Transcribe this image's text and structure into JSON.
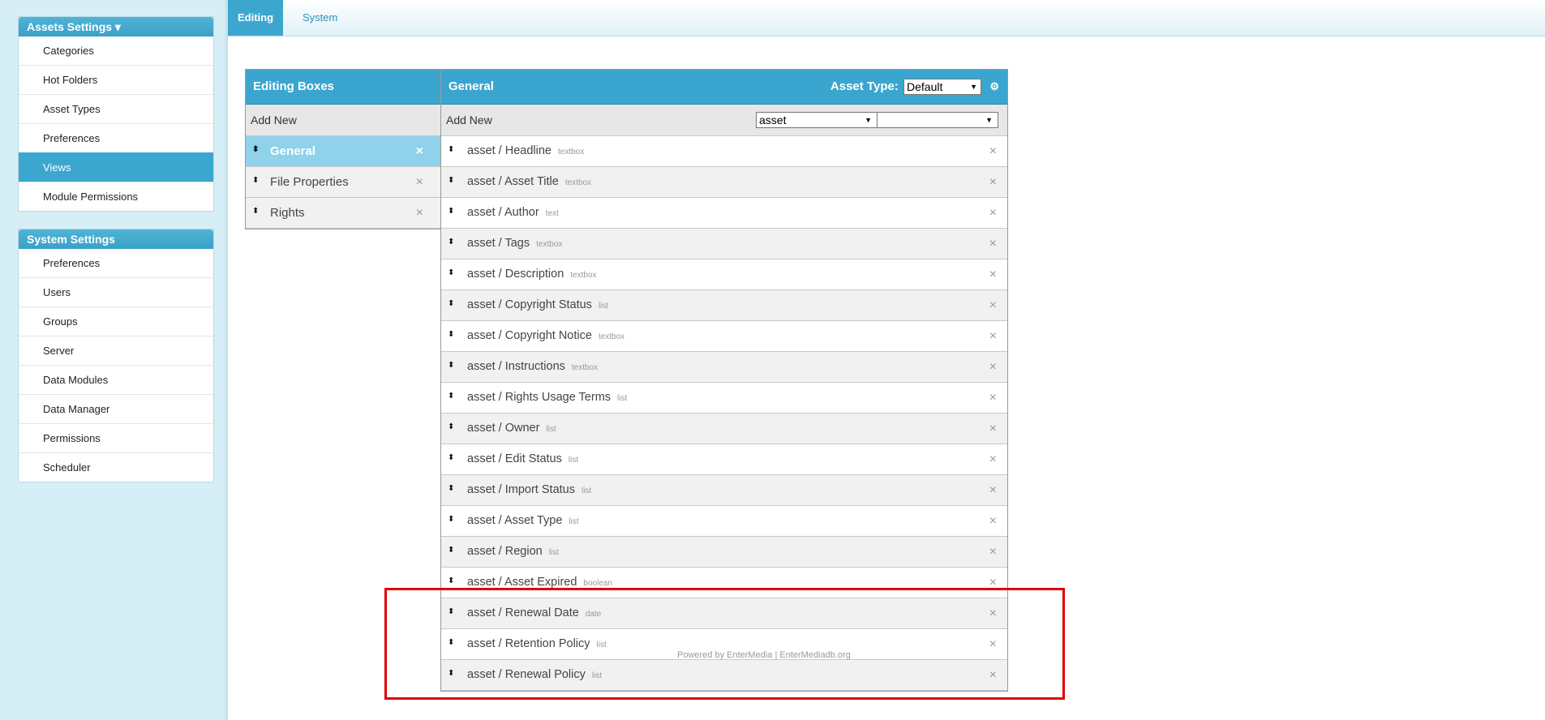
{
  "sidebar": {
    "assets_settings": {
      "title": "Assets Settings ▾",
      "items": [
        {
          "label": "Categories"
        },
        {
          "label": "Hot Folders"
        },
        {
          "label": "Asset Types"
        },
        {
          "label": "Preferences"
        },
        {
          "label": "Views"
        },
        {
          "label": "Module Permissions"
        }
      ]
    },
    "system_settings": {
      "title": "System Settings",
      "items": [
        {
          "label": "Preferences"
        },
        {
          "label": "Users"
        },
        {
          "label": "Groups"
        },
        {
          "label": "Server"
        },
        {
          "label": "Data Modules"
        },
        {
          "label": "Data Manager"
        },
        {
          "label": "Permissions"
        },
        {
          "label": "Scheduler"
        }
      ]
    }
  },
  "tabs": [
    {
      "label": "Editing"
    },
    {
      "label": "System"
    }
  ],
  "editing_boxes": {
    "title": "Editing Boxes",
    "add_new": "Add New",
    "items": [
      {
        "label": "General"
      },
      {
        "label": "File Properties"
      },
      {
        "label": "Rights"
      }
    ]
  },
  "general": {
    "title": "General",
    "asset_type_label": "Asset Type:",
    "asset_type_value": "Default",
    "add_new": "Add New",
    "select_1": "asset",
    "select_2": "",
    "fields": [
      {
        "label": "asset / Headline",
        "type": "textbox"
      },
      {
        "label": "asset / Asset Title",
        "type": "textbox"
      },
      {
        "label": "asset / Author",
        "type": "text"
      },
      {
        "label": "asset / Tags",
        "type": "textbox"
      },
      {
        "label": "asset / Description",
        "type": "textbox"
      },
      {
        "label": "asset / Copyright Status",
        "type": "list"
      },
      {
        "label": "asset / Copyright Notice",
        "type": "textbox"
      },
      {
        "label": "asset / Instructions",
        "type": "textbox"
      },
      {
        "label": "asset / Rights Usage Terms",
        "type": "list"
      },
      {
        "label": "asset / Owner",
        "type": "list"
      },
      {
        "label": "asset / Edit Status",
        "type": "list"
      },
      {
        "label": "asset / Import Status",
        "type": "list"
      },
      {
        "label": "asset / Asset Type",
        "type": "list"
      },
      {
        "label": "asset / Region",
        "type": "list"
      },
      {
        "label": "asset / Asset Expired",
        "type": "boolean"
      },
      {
        "label": "asset / Renewal Date",
        "type": "date"
      },
      {
        "label": "asset / Retention Policy",
        "type": "list"
      },
      {
        "label": "asset / Renewal Policy",
        "type": "list"
      }
    ]
  },
  "footer": "Powered by EnterMedia | EnterMediadb.org",
  "icons": {
    "sort": "⬍",
    "close": "×",
    "gear": "⚙",
    "dropdown": "▼"
  },
  "colors": {
    "accent": "#3ba7cf",
    "sidebar_bg": "#d6eef5",
    "highlight": "#e00000"
  }
}
